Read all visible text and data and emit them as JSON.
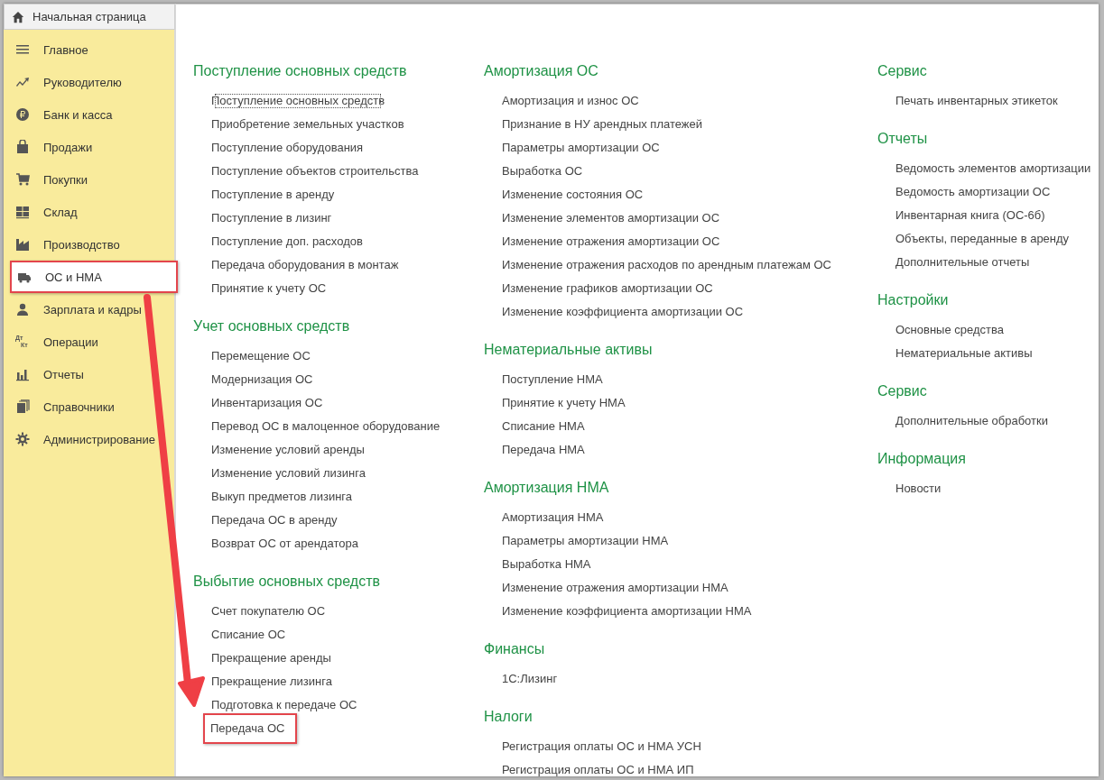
{
  "home_tab": {
    "label": "Начальная страница"
  },
  "sidebar": {
    "items": [
      {
        "label": "Главное",
        "selected": false,
        "highlighted": false
      },
      {
        "label": "Руководителю",
        "selected": false,
        "highlighted": false
      },
      {
        "label": "Банк и касса",
        "selected": false,
        "highlighted": false
      },
      {
        "label": "Продажи",
        "selected": false,
        "highlighted": false
      },
      {
        "label": "Покупки",
        "selected": false,
        "highlighted": false
      },
      {
        "label": "Склад",
        "selected": false,
        "highlighted": false
      },
      {
        "label": "Производство",
        "selected": false,
        "highlighted": false
      },
      {
        "label": "ОС и НМА",
        "selected": true,
        "highlighted": true
      },
      {
        "label": "Зарплата и кадры",
        "selected": false,
        "highlighted": false
      },
      {
        "label": "Операции",
        "selected": false,
        "highlighted": false,
        "icon_text": [
          "Дт",
          "Кт"
        ]
      },
      {
        "label": "Отчеты",
        "selected": false,
        "highlighted": false
      },
      {
        "label": "Справочники",
        "selected": false,
        "highlighted": false
      },
      {
        "label": "Администрирование",
        "selected": false,
        "highlighted": false
      }
    ]
  },
  "columns": [
    [
      {
        "title": "Поступление основных средств",
        "links": [
          {
            "label": "Поступление основных средств",
            "focused": true,
            "highlighted": false
          },
          {
            "label": "Приобретение земельных участков",
            "focused": false,
            "highlighted": false
          },
          {
            "label": "Поступление оборудования",
            "focused": false,
            "highlighted": false
          },
          {
            "label": "Поступление объектов строительства",
            "focused": false,
            "highlighted": false
          },
          {
            "label": "Поступление в аренду",
            "focused": false,
            "highlighted": false
          },
          {
            "label": "Поступление в лизинг",
            "focused": false,
            "highlighted": false
          },
          {
            "label": "Поступление доп. расходов",
            "focused": false,
            "highlighted": false
          },
          {
            "label": "Передача оборудования в монтаж",
            "focused": false,
            "highlighted": false
          },
          {
            "label": "Принятие к учету ОС",
            "focused": false,
            "highlighted": false
          }
        ]
      },
      {
        "title": "Учет основных средств",
        "links": [
          {
            "label": "Перемещение ОС",
            "focused": false,
            "highlighted": false
          },
          {
            "label": "Модернизация ОС",
            "focused": false,
            "highlighted": false
          },
          {
            "label": "Инвентаризация ОС",
            "focused": false,
            "highlighted": false
          },
          {
            "label": "Перевод ОС в малоценное оборудование",
            "focused": false,
            "highlighted": false
          },
          {
            "label": "Изменение условий аренды",
            "focused": false,
            "highlighted": false
          },
          {
            "label": "Изменение условий лизинга",
            "focused": false,
            "highlighted": false
          },
          {
            "label": "Выкуп предметов лизинга",
            "focused": false,
            "highlighted": false
          },
          {
            "label": "Передача ОС в аренду",
            "focused": false,
            "highlighted": false
          },
          {
            "label": "Возврат ОС от арендатора",
            "focused": false,
            "highlighted": false
          }
        ]
      },
      {
        "title": "Выбытие основных средств",
        "links": [
          {
            "label": "Счет покупателю ОС",
            "focused": false,
            "highlighted": false
          },
          {
            "label": "Списание ОС",
            "focused": false,
            "highlighted": false
          },
          {
            "label": "Прекращение аренды",
            "focused": false,
            "highlighted": false
          },
          {
            "label": "Прекращение лизинга",
            "focused": false,
            "highlighted": false
          },
          {
            "label": "Подготовка к передаче ОС",
            "focused": false,
            "highlighted": false
          },
          {
            "label": "Передача ОС",
            "focused": false,
            "highlighted": true
          }
        ]
      }
    ],
    [
      {
        "title": "Амортизация ОС",
        "links": [
          {
            "label": "Амортизация и износ ОС",
            "focused": false,
            "highlighted": false
          },
          {
            "label": "Признание в НУ арендных платежей",
            "focused": false,
            "highlighted": false
          },
          {
            "label": "Параметры амортизации ОС",
            "focused": false,
            "highlighted": false
          },
          {
            "label": "Выработка ОС",
            "focused": false,
            "highlighted": false
          },
          {
            "label": "Изменение состояния ОС",
            "focused": false,
            "highlighted": false
          },
          {
            "label": "Изменение элементов амортизации ОС",
            "focused": false,
            "highlighted": false
          },
          {
            "label": "Изменение отражения амортизации ОС",
            "focused": false,
            "highlighted": false
          },
          {
            "label": "Изменение отражения расходов по арендным платежам ОС",
            "focused": false,
            "highlighted": false
          },
          {
            "label": "Изменение графиков амортизации ОС",
            "focused": false,
            "highlighted": false
          },
          {
            "label": "Изменение коэффициента амортизации ОС",
            "focused": false,
            "highlighted": false
          }
        ]
      },
      {
        "title": "Нематериальные активы",
        "links": [
          {
            "label": "Поступление НМА",
            "focused": false,
            "highlighted": false
          },
          {
            "label": "Принятие к учету НМА",
            "focused": false,
            "highlighted": false
          },
          {
            "label": "Списание НМА",
            "focused": false,
            "highlighted": false
          },
          {
            "label": "Передача НМА",
            "focused": false,
            "highlighted": false
          }
        ]
      },
      {
        "title": "Амортизация НМА",
        "links": [
          {
            "label": "Амортизация НМА",
            "focused": false,
            "highlighted": false
          },
          {
            "label": "Параметры амортизации НМА",
            "focused": false,
            "highlighted": false
          },
          {
            "label": "Выработка НМА",
            "focused": false,
            "highlighted": false
          },
          {
            "label": "Изменение отражения амортизации НМА",
            "focused": false,
            "highlighted": false
          },
          {
            "label": "Изменение коэффициента амортизации НМА",
            "focused": false,
            "highlighted": false
          }
        ]
      },
      {
        "title": "Финансы",
        "links": [
          {
            "label": "1С:Лизинг",
            "focused": false,
            "highlighted": false
          }
        ]
      },
      {
        "title": "Налоги",
        "links": [
          {
            "label": "Регистрация оплаты ОС и НМА УСН",
            "focused": false,
            "highlighted": false
          },
          {
            "label": "Регистрация оплаты ОС и НМА ИП",
            "focused": false,
            "highlighted": false
          }
        ]
      }
    ],
    [
      {
        "title": "Сервис",
        "links": [
          {
            "label": "Печать инвентарных этикеток",
            "focused": false,
            "highlighted": false
          }
        ]
      },
      {
        "title": "Отчеты",
        "links": [
          {
            "label": "Ведомость элементов амортизации",
            "focused": false,
            "highlighted": false
          },
          {
            "label": "Ведомость амортизации ОС",
            "focused": false,
            "highlighted": false
          },
          {
            "label": "Инвентарная книга (ОС-6б)",
            "focused": false,
            "highlighted": false
          },
          {
            "label": "Объекты, переданные в аренду",
            "focused": false,
            "highlighted": false
          },
          {
            "label": "Дополнительные отчеты",
            "focused": false,
            "highlighted": false
          }
        ]
      },
      {
        "title": "Настройки",
        "links": [
          {
            "label": "Основные средства",
            "focused": false,
            "highlighted": false
          },
          {
            "label": "Нематериальные активы",
            "focused": false,
            "highlighted": false
          }
        ]
      },
      {
        "title": "Сервис",
        "links": [
          {
            "label": "Дополнительные обработки",
            "focused": false,
            "highlighted": false
          }
        ]
      },
      {
        "title": "Информация",
        "links": [
          {
            "label": "Новости",
            "focused": false,
            "highlighted": false
          }
        ]
      }
    ]
  ]
}
